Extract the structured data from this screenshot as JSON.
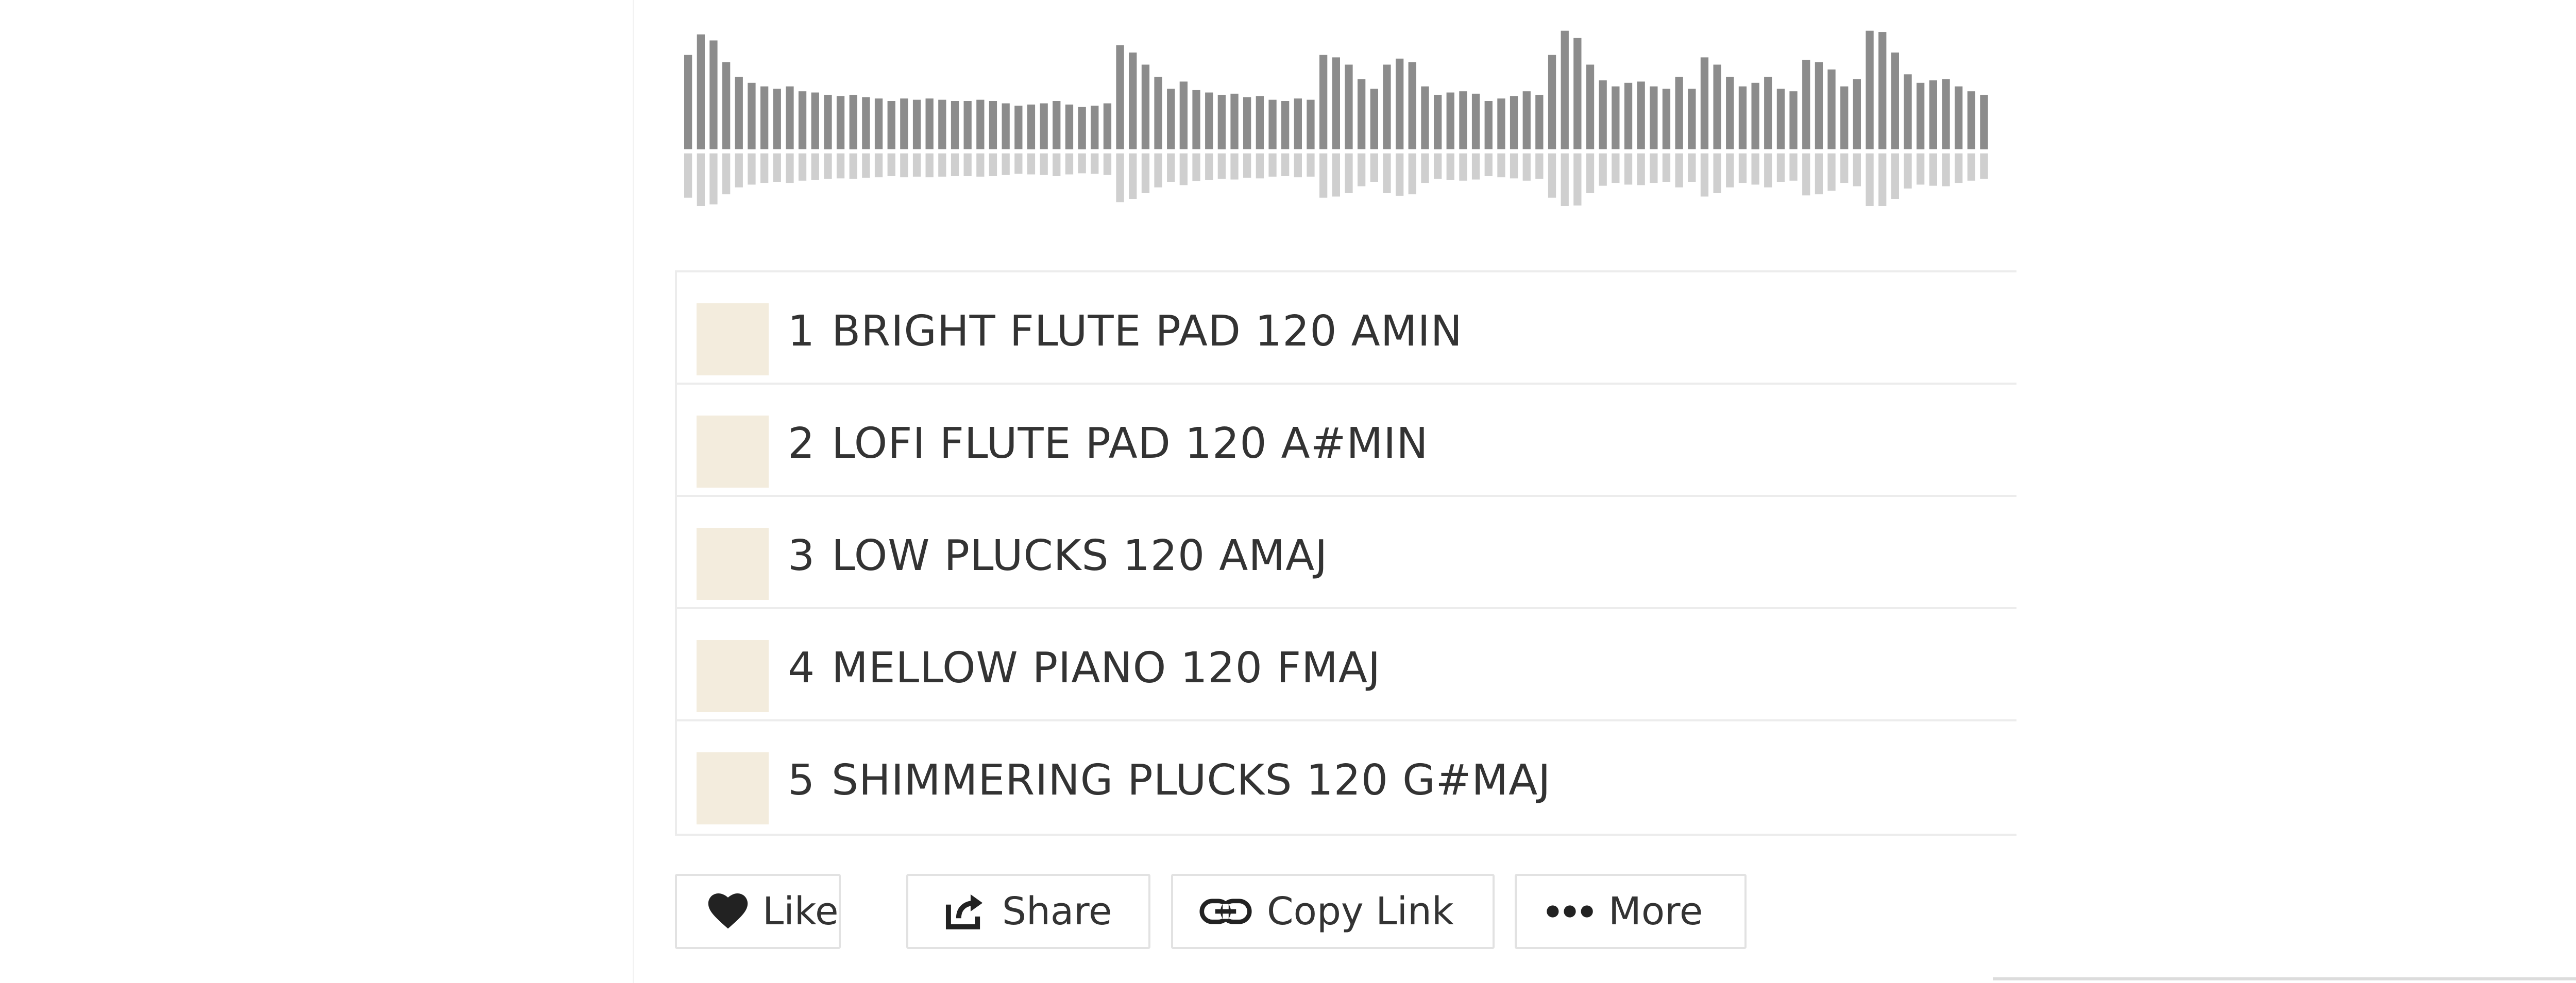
{
  "tracks": [
    {
      "number": "1",
      "title": "BRIGHT FLUTE PAD 120 AMIN"
    },
    {
      "number": "2",
      "title": "LOFI FLUTE PAD 120 A#MIN"
    },
    {
      "number": "3",
      "title": "LOW PLUCKS 120 AMAJ"
    },
    {
      "number": "4",
      "title": "MELLOW PIANO 120 FMAJ"
    },
    {
      "number": "5",
      "title": "SHIMMERING PLUCKS 120 G#MAJ"
    }
  ],
  "actions": {
    "like_label": "Like",
    "share_label": "Share",
    "copy_link_label": "Copy Link",
    "more_label": "More"
  },
  "icons": {
    "like": "heart-icon",
    "share": "share-icon",
    "copy_link": "link-icon",
    "more": "ellipsis-icon"
  },
  "colors": {
    "waveform_top": "#8c8c8c",
    "waveform_bottom": "#cfcfcf",
    "artwork_placeholder": "#f3ecdd",
    "text": "#333333"
  }
}
